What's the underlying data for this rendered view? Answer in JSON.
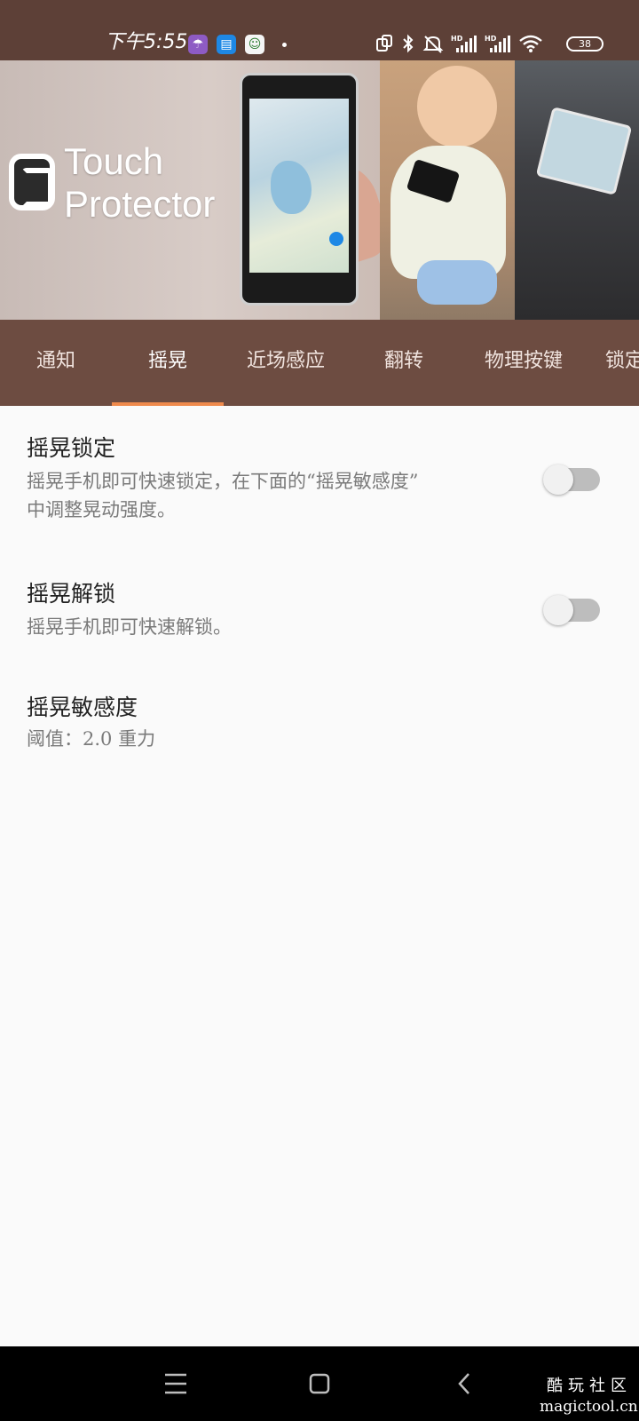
{
  "status_bar": {
    "time": "下午5:55",
    "battery": "38",
    "background": "#5d4037"
  },
  "banner": {
    "logo_line1": "Touch",
    "logo_line2": "Protector"
  },
  "tabs": [
    {
      "label": "通知",
      "selected": false
    },
    {
      "label": "摇晃",
      "selected": true
    },
    {
      "label": "近场感应",
      "selected": false
    },
    {
      "label": "翻转",
      "selected": false
    },
    {
      "label": "物理按键",
      "selected": false
    },
    {
      "label": "锁定",
      "selected": false
    }
  ],
  "settings": {
    "shake_lock": {
      "title": "摇晃锁定",
      "summary_line1": "摇晃手机即可快速锁定，在下面的“摇晃敏感度”",
      "summary_line2": "中调整晃动强度。",
      "enabled": false
    },
    "shake_unlock": {
      "title": "摇晃解锁",
      "summary": "摇晃手机即可快速解锁。",
      "enabled": false
    },
    "shake_sensitivity": {
      "title": "摇晃敏感度",
      "summary": "阈值：2.0 重力"
    }
  },
  "watermark": {
    "line1": "酷玩社区",
    "line2": "magictool.cn"
  },
  "colors": {
    "tab_bar": "#6d4c41",
    "tab_indicator": "#ef8a4c",
    "background": "#fafafa"
  }
}
